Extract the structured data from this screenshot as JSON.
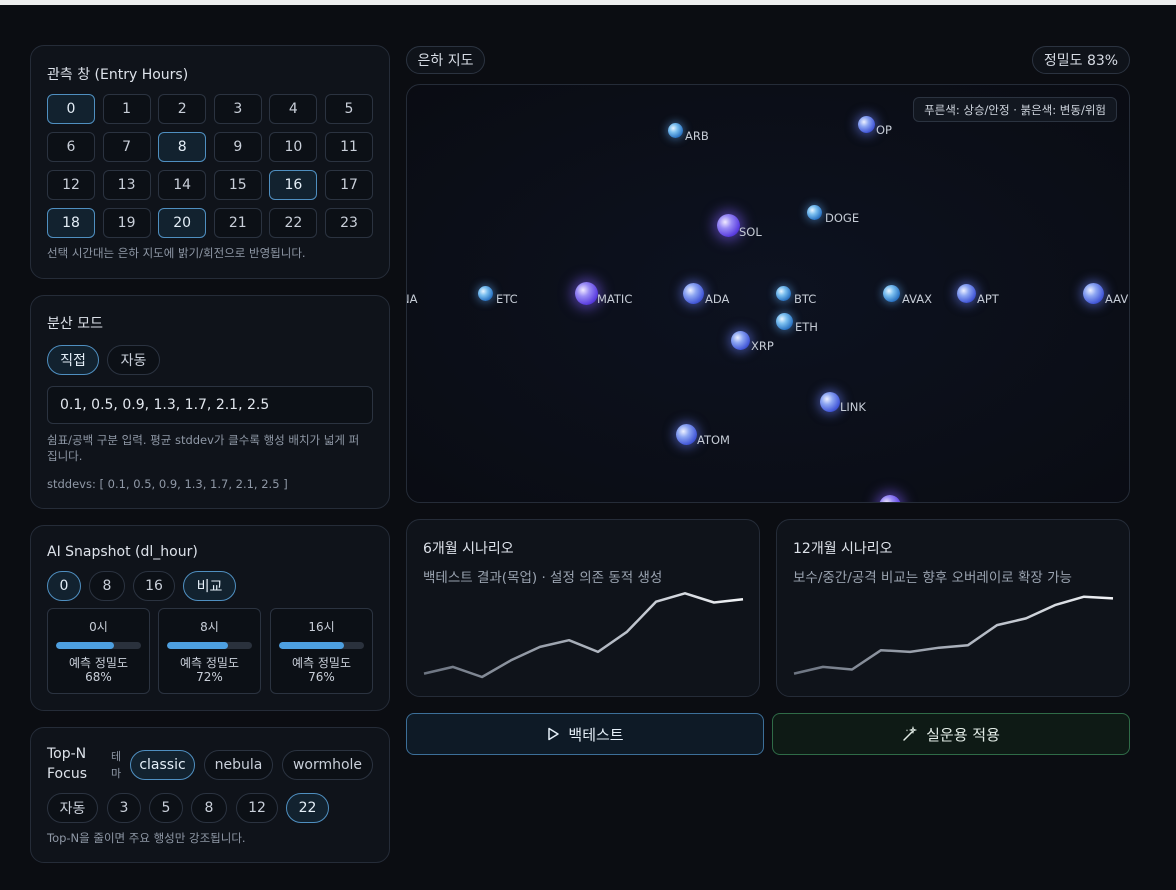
{
  "entry_hours": {
    "title": "관측 창 (Entry Hours)",
    "hours": [
      "0",
      "1",
      "2",
      "3",
      "4",
      "5",
      "6",
      "7",
      "8",
      "9",
      "10",
      "11",
      "12",
      "13",
      "14",
      "15",
      "16",
      "17",
      "18",
      "19",
      "20",
      "21",
      "22",
      "23"
    ],
    "selected": [
      "0",
      "8",
      "16",
      "18",
      "20"
    ],
    "hint": "선택 시간대는 은하 지도에 밝기/회전으로 반영됩니다."
  },
  "dispersion": {
    "title": "분산 모드",
    "modes": [
      "직접",
      "자동"
    ],
    "selected_mode": "직접",
    "input_value": "0.1, 0.5, 0.9, 1.3, 1.7, 2.1, 2.5",
    "hint_line1": "쉼표/공백 구분 입력. 평균 stddev가 클수록 행성 배치가 넓게 퍼",
    "hint_line2": "집니다.",
    "stddevs": "stddevs: [ 0.1, 0.5, 0.9, 1.3, 1.7, 2.1, 2.5 ]"
  },
  "snapshot": {
    "title": "AI Snapshot (dl_hour)",
    "tabs": [
      "0",
      "8",
      "16",
      "비교"
    ],
    "selected_tabs": [
      "0",
      "비교"
    ],
    "cards": [
      {
        "hour": "0시",
        "label": "예측 정밀도",
        "value": "68%",
        "fill": 0.68
      },
      {
        "hour": "8시",
        "label": "예측 정밀도",
        "value": "72%",
        "fill": 0.72
      },
      {
        "hour": "16시",
        "label": "예측 정밀도",
        "value": "76%",
        "fill": 0.76
      }
    ]
  },
  "topn": {
    "title_line1": "Top-N",
    "title_line2": "Focus",
    "theme_label_1": "테",
    "theme_label_2": "마",
    "themes": [
      "classic",
      "nebula",
      "wormhole"
    ],
    "selected_theme": "classic",
    "counts": [
      "자동",
      "3",
      "5",
      "8",
      "12",
      "22"
    ],
    "selected_count": "22",
    "hint": "Top-N을 줄이면 주요 행성만 강조됩니다."
  },
  "galaxy": {
    "title": "은하 지도",
    "accuracy": "정밀도 83%",
    "legend": "푸른색: 상승/안정 · 붉은색: 변동/위험",
    "stars": [
      "ARB",
      "OP",
      "DOGE",
      "SOL",
      "NA",
      "ETC",
      "MATIC",
      "ADA",
      "BTC",
      "AVAX",
      "APT",
      "AAVE",
      "ETH",
      "XRP",
      "LINK",
      "ATOM"
    ]
  },
  "scenarios": [
    {
      "title": "6개월 시나리오",
      "subtitle": "백테스트 결과(목업) · 설정 의존 동적 생성",
      "values": [
        10,
        18,
        6,
        26,
        42,
        50,
        36,
        60,
        96,
        106,
        95,
        99
      ]
    },
    {
      "title": "12개월 시나리오",
      "subtitle": "보수/중간/공격 비교는 향후 오버레이로 확장 가능",
      "values": [
        10,
        18,
        15,
        38,
        36,
        41,
        44,
        68,
        76,
        92,
        102,
        100
      ]
    }
  ],
  "actions": {
    "backtest": "백테스트",
    "apply": "실운용 적용"
  },
  "colors": {
    "background": "#0b0d12",
    "card": "#0f131a",
    "accent": "#4f8fc0",
    "progress": "#4d9fe0",
    "apply_border": "#2f6b47"
  }
}
